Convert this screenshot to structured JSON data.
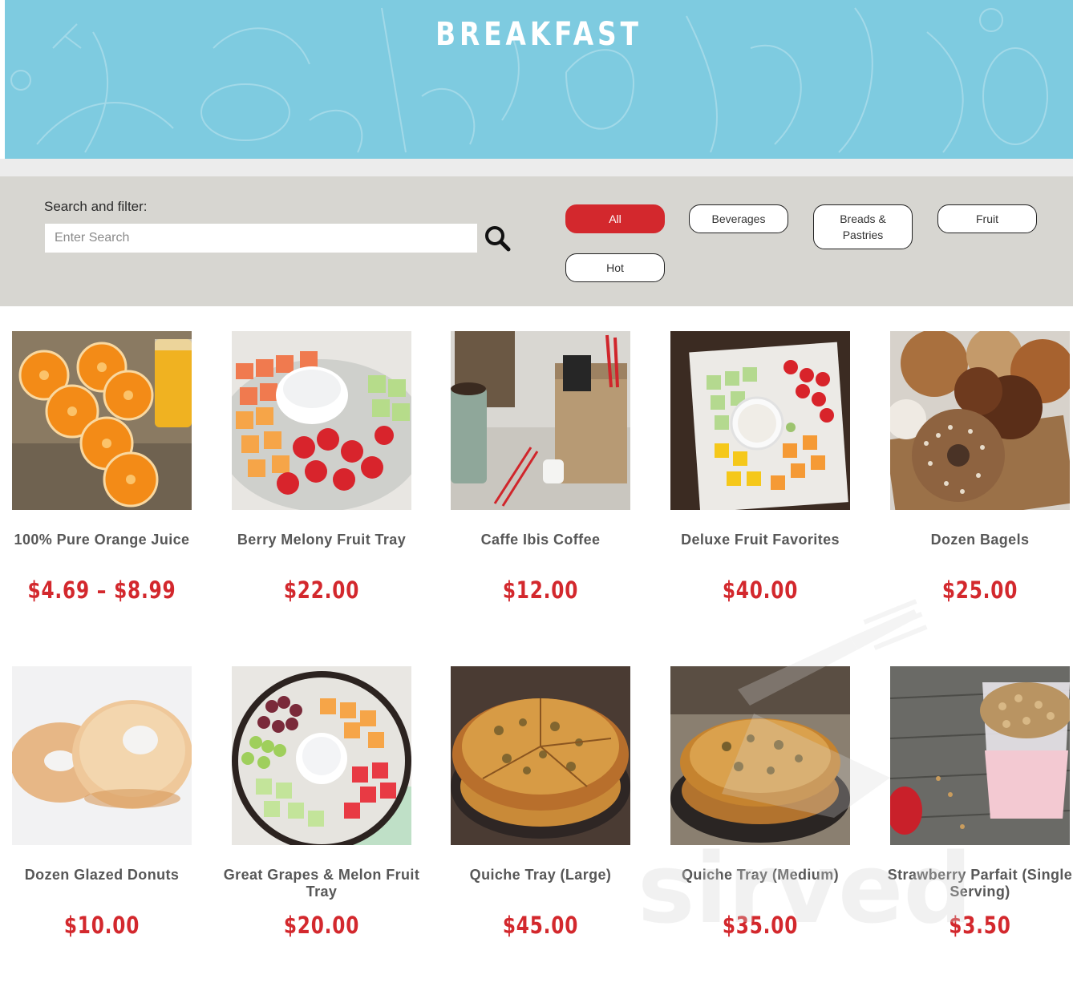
{
  "hero": {
    "title": "BREAKFAST"
  },
  "filter": {
    "label": "Search and filter:",
    "search_placeholder": "Enter Search",
    "search_value": "",
    "categories": [
      {
        "label": "All",
        "active": true
      },
      {
        "label": "Beverages",
        "active": false
      },
      {
        "label": "Breads &\nPastries",
        "active": false
      },
      {
        "label": "Fruit",
        "active": false
      },
      {
        "label": "Hot",
        "active": false
      }
    ]
  },
  "products": [
    {
      "name": "100% Pure Orange Juice",
      "price": "$4.69 – $8.99",
      "image": "orange-juice-photo"
    },
    {
      "name": "Berry Melony Fruit Tray",
      "price": "$22.00",
      "image": "fruit-tray-photo"
    },
    {
      "name": "Caffe Ibis Coffee",
      "price": "$12.00",
      "image": "coffee-carafe-photo"
    },
    {
      "name": "Deluxe Fruit Favorites",
      "price": "$40.00",
      "image": "fruit-platter-photo"
    },
    {
      "name": "Dozen Bagels",
      "price": "$25.00",
      "image": "bagels-photo"
    },
    {
      "name": "Dozen Glazed Donuts",
      "price": "$10.00",
      "image": "donuts-photo"
    },
    {
      "name": "Great Grapes & Melon Fruit Tray",
      "price": "$20.00",
      "image": "grape-melon-tray-photo"
    },
    {
      "name": "Quiche Tray (Large)",
      "price": "$45.00",
      "image": "quiche-large-photo"
    },
    {
      "name": "Quiche Tray (Medium)",
      "price": "$35.00",
      "image": "quiche-medium-photo"
    },
    {
      "name": "Strawberry Parfait (Single Serving)",
      "price": "$3.50",
      "image": "parfait-photo"
    }
  ],
  "watermark": {
    "text": "sirved"
  },
  "colors": {
    "accent": "#d3282d",
    "hero": "#7ecbe0",
    "panel": "#d7d6d1",
    "text": "#575757"
  }
}
